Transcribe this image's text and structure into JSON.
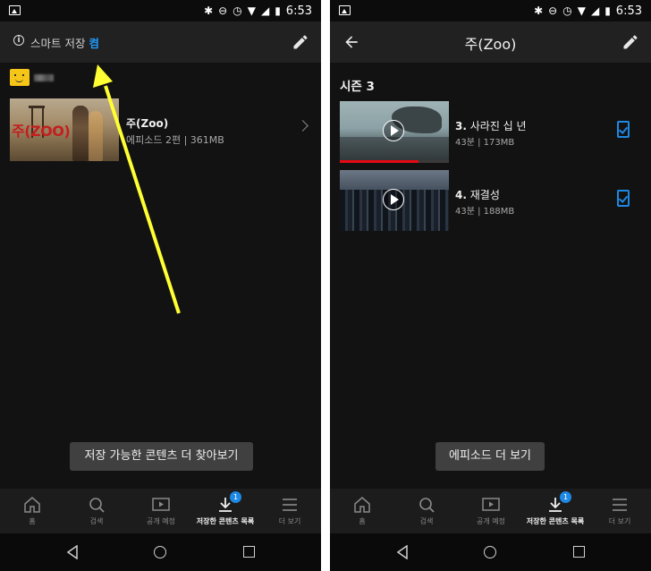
{
  "status_bar": {
    "time": "6:53"
  },
  "left_screen": {
    "smart_download": {
      "label": "스마트 저장",
      "state": "켬"
    },
    "show": {
      "title": "주(Zoo)",
      "poster_text": "주(ZOO)",
      "meta": "에피소드 2편 | 361MB"
    },
    "find_more_button": "저장 가능한 콘텐츠 더 찾아보기",
    "annotation": {
      "color": "#ffff33"
    }
  },
  "right_screen": {
    "title": "주(Zoo)",
    "season": "시즌 3",
    "episodes": [
      {
        "number": "3.",
        "title": "사라진 십 년",
        "meta": "43분 | 173MB",
        "progress": 0.72,
        "checked": true
      },
      {
        "number": "4.",
        "title": "재결성",
        "meta": "43분 | 188MB",
        "progress": 0,
        "checked": true
      }
    ],
    "more_episodes_button": "에피소드 더 보기"
  },
  "bottom_nav": {
    "items": [
      {
        "label": "홈",
        "icon": "home-icon"
      },
      {
        "label": "검색",
        "icon": "search-icon"
      },
      {
        "label": "공개 예정",
        "icon": "coming-soon-icon"
      },
      {
        "label": "저장한 콘텐츠 목록",
        "icon": "download-icon",
        "badge": "1"
      },
      {
        "label": "더 보기",
        "icon": "menu-icon"
      }
    ]
  },
  "colors": {
    "accent": "#1e88e5",
    "progress": "#e50914",
    "background": "#121212"
  }
}
